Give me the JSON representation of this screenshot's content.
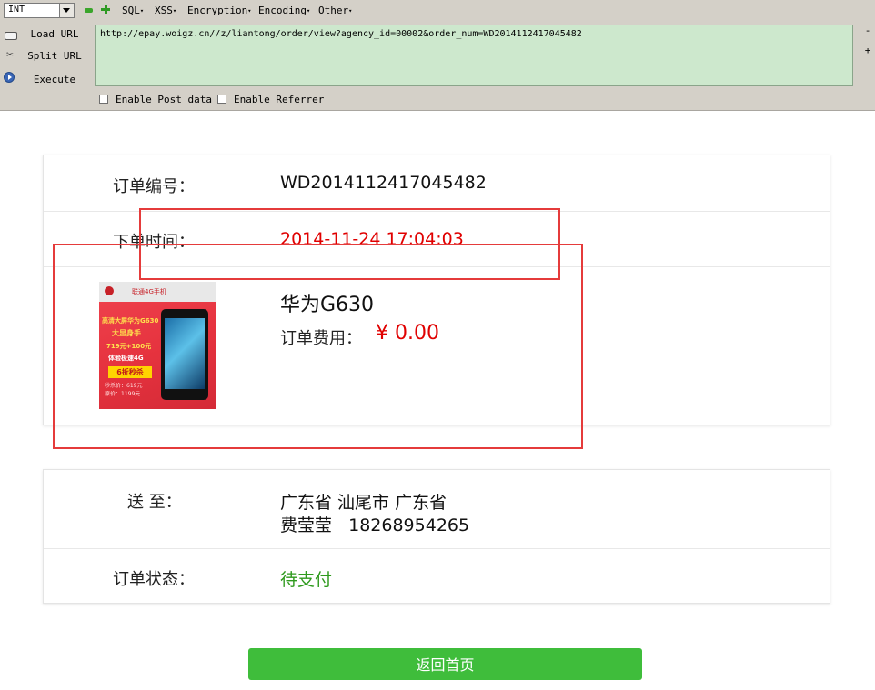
{
  "hackbar": {
    "select_value": "INT",
    "menus": [
      "SQL",
      "XSS",
      "Encryption",
      "Encoding",
      "Other"
    ],
    "load_url": "Load URL",
    "split_url": "Split URL",
    "execute": "Execute",
    "url": "http://epay.woigz.cn//z/liantong/order/view?agency_id=00002&order_num=WD2014112417045482",
    "enable_post": "Enable Post data",
    "enable_referrer": "Enable Referrer",
    "scroll_minus": "-",
    "scroll_plus": "+"
  },
  "order": {
    "number_label": "订单编号：",
    "number_value": "WD2014112417045482",
    "time_label": "下单时间：",
    "time_value": "2014-11-24 17:04:03",
    "product_name": "华为G630",
    "fee_label": "订单费用：",
    "fee_value": "¥ 0.00"
  },
  "product_image": {
    "brand_line": "联通4G手机",
    "promo_1": "高清大屏华为G630",
    "promo_2": "大显身手",
    "promo_3": "719元+100元",
    "promo_4": "体验极速4G",
    "tag": "6折秒杀",
    "small_1": "秒杀价：619元",
    "small_2": "原价：1199元"
  },
  "delivery": {
    "ship_label": "送 至：",
    "address": "广东省 汕尾市 广东省",
    "contact": "费莹莹   18268954265",
    "status_label": "订单状态：",
    "status_value": "待支付"
  },
  "actions": {
    "back_home": "返回首页"
  },
  "colors": {
    "accent_green": "#3fbd3b",
    "status_green": "#2f9a1e",
    "alert_red": "#e00000",
    "highlight_box": "#e53b3b",
    "url_bg": "#cde8cd"
  }
}
